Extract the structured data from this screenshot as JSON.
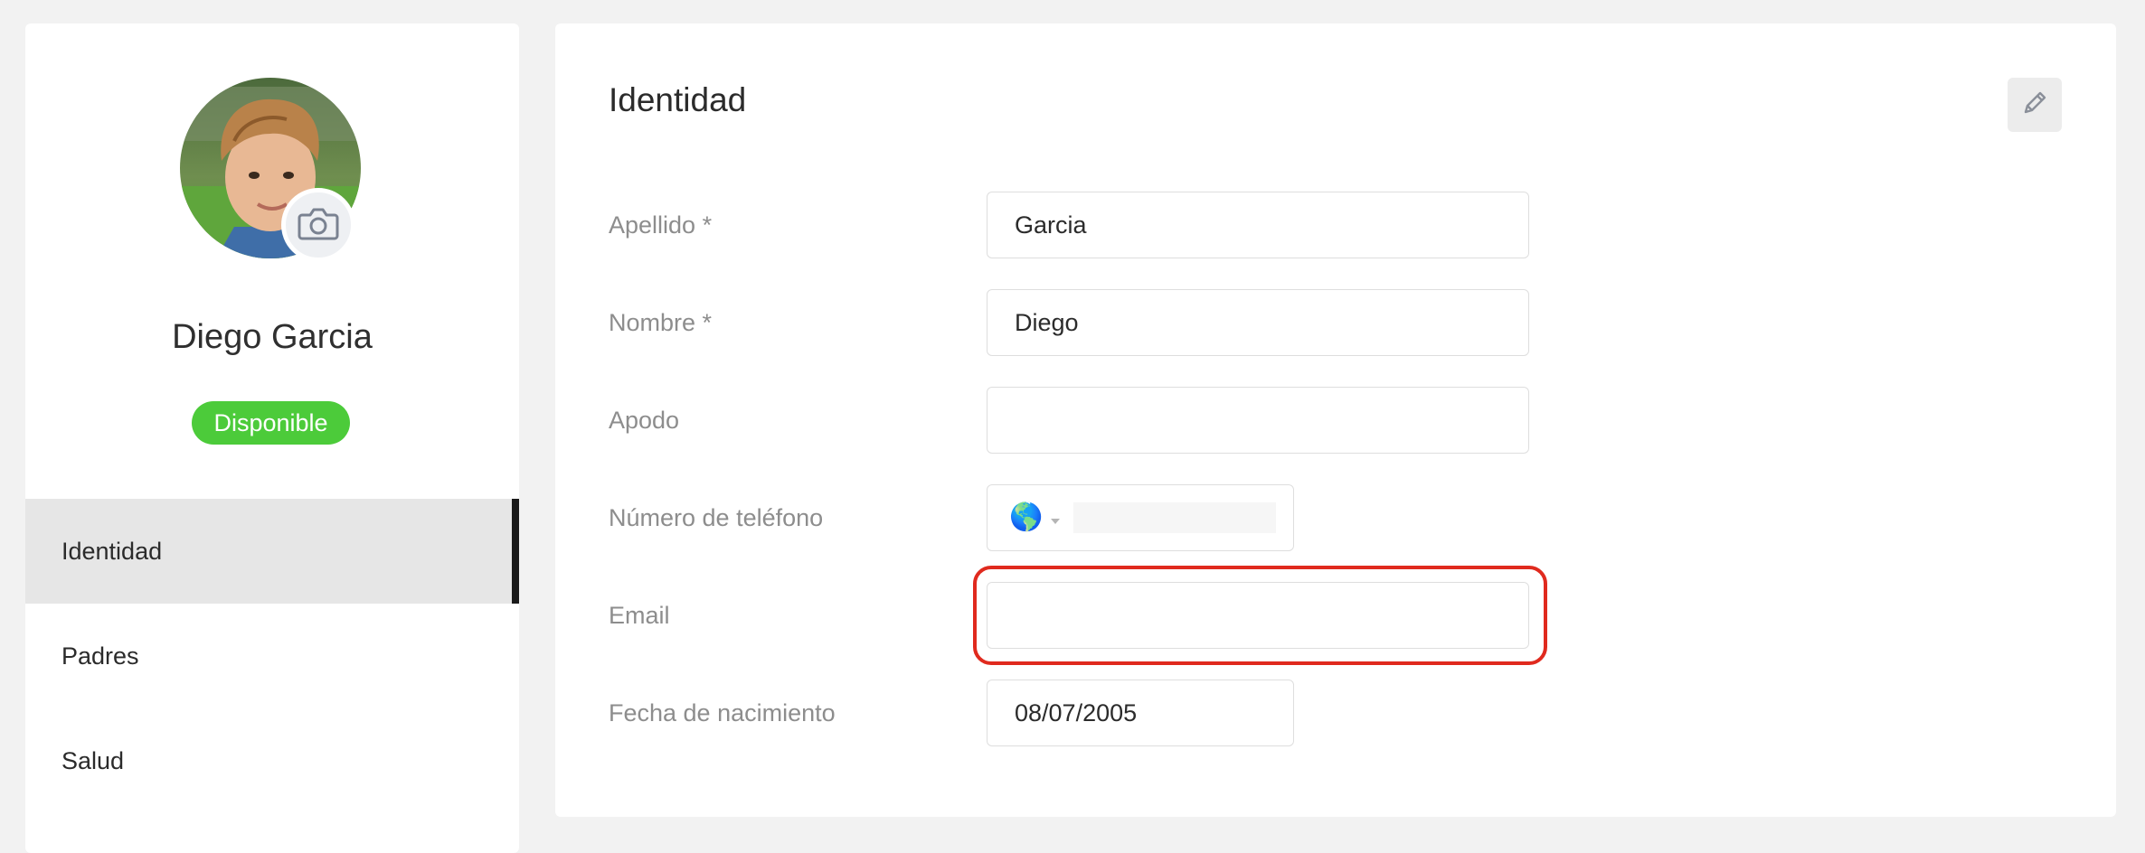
{
  "profile": {
    "name": "Diego Garcia",
    "status": "Disponible",
    "avatar_icon": "child-portrait-photo",
    "camera_icon": "camera-icon"
  },
  "nav": {
    "items": [
      {
        "label": "Identidad",
        "active": true
      },
      {
        "label": "Padres",
        "active": false
      },
      {
        "label": "Salud",
        "active": false
      }
    ]
  },
  "identity": {
    "title": "Identidad",
    "edit_icon": "pencil-icon",
    "fields": {
      "last_name": {
        "label": "Apellido *",
        "value": "Garcia"
      },
      "first_name": {
        "label": "Nombre *",
        "value": "Diego"
      },
      "nickname": {
        "label": "Apodo",
        "value": ""
      },
      "phone": {
        "label": "Número de teléfono",
        "country_flag": "🌎",
        "value": ""
      },
      "email": {
        "label": "Email",
        "value": ""
      },
      "birthdate": {
        "label": "Fecha de nacimiento",
        "value": "08/07/2005"
      }
    }
  },
  "colors": {
    "status_green": "#4ccb3a",
    "highlight_red": "#e02a1e",
    "active_nav_bar": "#1a1a1a"
  }
}
